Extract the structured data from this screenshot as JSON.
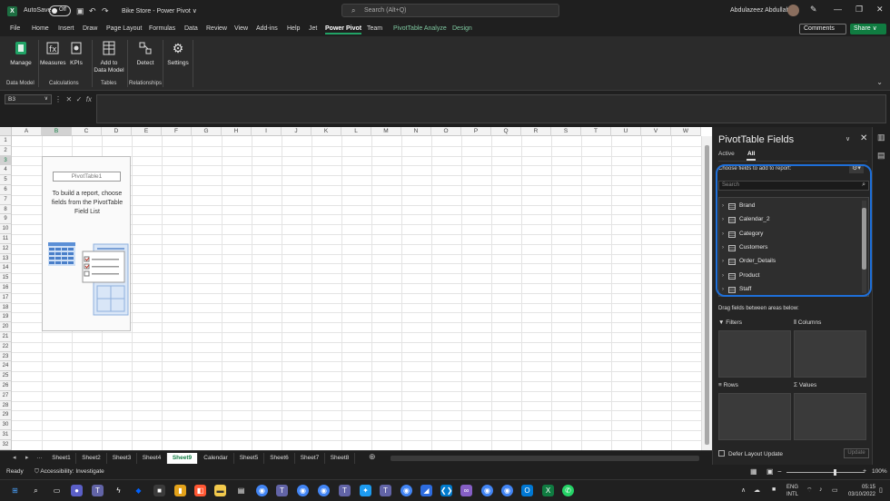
{
  "titlebar": {
    "app_letter": "X",
    "autosave_label": "AutoSave",
    "autosave_state": "Off",
    "doc_title": "Bike Store - Power Pivot ∨",
    "search_placeholder": "Search (Alt+Q)",
    "user_name": "Abdulazeez Abdullah"
  },
  "menu": {
    "tabs": [
      "File",
      "Home",
      "Insert",
      "Draw",
      "Page Layout",
      "Formulas",
      "Data",
      "Review",
      "View",
      "Add-ins",
      "Help",
      "Jet",
      "Power Pivot",
      "Team",
      "PivotTable Analyze",
      "Design"
    ],
    "active_tab": "Power Pivot",
    "comments_label": "Comments",
    "share_label": "Share ∨"
  },
  "ribbon": {
    "buttons": {
      "manage": "Manage",
      "measures": "Measures",
      "kpis": "KPIs",
      "add_to_data_model": "Add to Data Model",
      "detect": "Detect",
      "settings": "Settings"
    },
    "groups": {
      "data_model": "Data Model",
      "calculations": "Calculations",
      "tables": "Tables",
      "relationships": "Relationships"
    }
  },
  "formula_bar": {
    "name_box": "B3",
    "formula": ""
  },
  "grid": {
    "columns": [
      "A",
      "B",
      "C",
      "D",
      "E",
      "F",
      "G",
      "H",
      "I",
      "J",
      "K",
      "L",
      "M",
      "N",
      "O",
      "P",
      "Q",
      "R",
      "S",
      "T",
      "U",
      "V",
      "W"
    ],
    "rows": [
      "1",
      "2",
      "3",
      "4",
      "5",
      "6",
      "7",
      "8",
      "9",
      "10",
      "11",
      "12",
      "13",
      "14",
      "15",
      "16",
      "17",
      "18",
      "19",
      "20",
      "21",
      "22",
      "23",
      "24",
      "25",
      "26",
      "27",
      "28",
      "29",
      "30",
      "31",
      "32"
    ],
    "pivot_placeholder": {
      "name": "PivotTable1",
      "help_line1": "To build a report, choose",
      "help_line2": "fields from the PivotTable",
      "help_line3": "Field List"
    }
  },
  "sheets": {
    "tabs": [
      "Sheet1",
      "Sheet2",
      "Sheet3",
      "Sheet4",
      "Sheet9",
      "Calendar",
      "Sheet5",
      "Sheet6",
      "Sheet7",
      "Sheet8"
    ],
    "active": "Sheet9"
  },
  "pivot_pane": {
    "title": "PivotTable Fields",
    "tab_active": "Active",
    "tab_all": "All",
    "choose_label": "Choose fields to add to report:",
    "search_placeholder": "Search",
    "fields": [
      "Brand",
      "Calendar_2",
      "Category",
      "Customers",
      "Order_Details",
      "Product",
      "Staff"
    ],
    "drag_label": "Drag fields between areas below:",
    "areas": {
      "filters": "Filters",
      "columns": "Columns",
      "rows": "Rows",
      "values": "Values"
    },
    "defer_label": "Defer Layout Update",
    "update_label": "Update",
    "highlight_color": "#1e6fd9"
  },
  "status": {
    "ready": "Ready",
    "accessibility": "Accessibility: Investigate",
    "zoom": "100%"
  },
  "taskbar": {
    "language_top": "ENG",
    "language_bottom": "INTL",
    "time": "05:15",
    "date": "03/10/2022"
  },
  "colors": {
    "excel_green": "#107c41",
    "accent_green": "#21a366",
    "dark_bg": "#1f1f1f"
  }
}
